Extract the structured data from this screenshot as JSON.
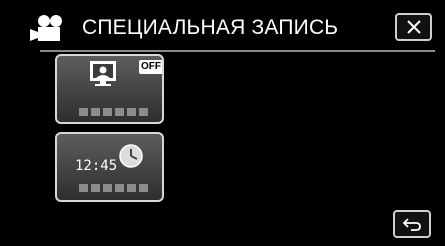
{
  "header": {
    "title": "СПЕЦИАЛЬНАЯ ЗАПИСЬ",
    "mode_icon": "video-camera-icon",
    "close_icon": "close-icon"
  },
  "options": [
    {
      "name": "portrait-option",
      "icon": "portrait-icon",
      "badge": "OFF",
      "value_indicator_count": 6
    },
    {
      "name": "timer-option",
      "icon": "clock-icon",
      "clock_text": "12:45",
      "value_indicator_count": 6
    }
  ],
  "footer": {
    "back_icon": "return-arrow-icon"
  },
  "colors": {
    "background": "#000000",
    "tile_border": "#d8d8d8",
    "tile_fill": "#4a4a4a",
    "divider": "#8a8a8a"
  }
}
